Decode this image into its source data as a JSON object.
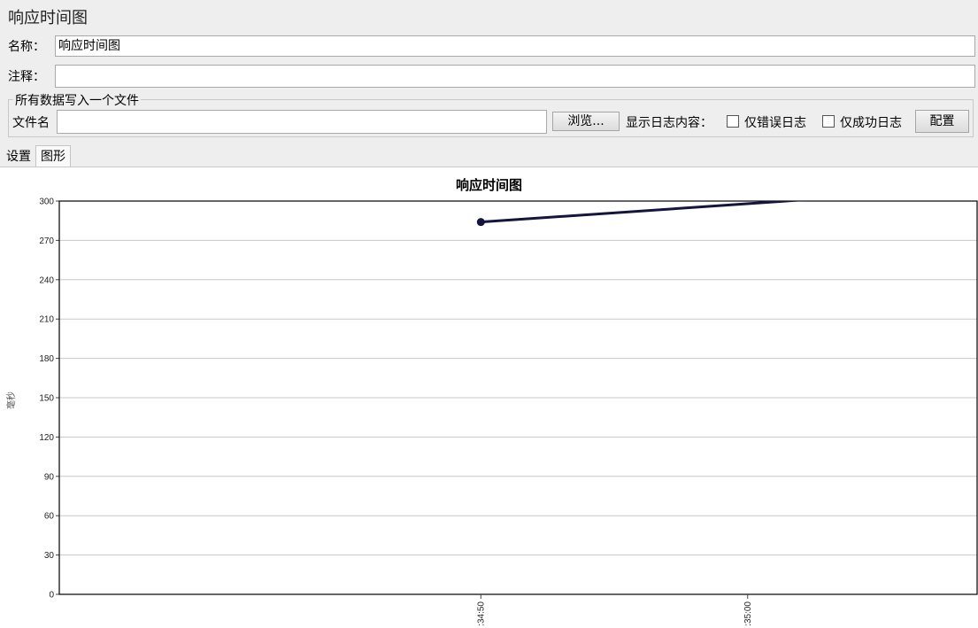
{
  "window": {
    "title": "响应时间图"
  },
  "form": {
    "name_label": "名称：",
    "name_value": "响应时间图",
    "comment_label": "注释：",
    "comment_value": ""
  },
  "file_group": {
    "legend": "所有数据写入一个文件",
    "filename_label": "文件名",
    "filename_value": "",
    "browse_button": "浏览...",
    "log_content_label": "显示日志内容：",
    "errors_only_label": "仅错误日志",
    "errors_only_checked": false,
    "success_only_label": "仅成功日志",
    "success_only_checked": false,
    "configure_button": "配置"
  },
  "tabs": [
    {
      "label": "设置",
      "active": false
    },
    {
      "label": "图形",
      "active": true
    }
  ],
  "chart_data": {
    "type": "line",
    "title": "响应时间图",
    "ylabel": "毫秒",
    "xlabel": "",
    "ylim": [
      0,
      300
    ],
    "yticks": [
      0,
      30,
      60,
      90,
      120,
      150,
      180,
      210,
      240,
      270,
      300
    ],
    "xticks": [
      ":34:50",
      ":35:00"
    ],
    "xlim_seconds": [
      -15.8,
      18.6
    ],
    "grid": true,
    "legend": "none",
    "series": [
      {
        "color": "#14143c",
        "points": [
          {
            "t": 0,
            "y": 284
          },
          {
            "t": 15,
            "y": 305
          }
        ]
      }
    ]
  }
}
